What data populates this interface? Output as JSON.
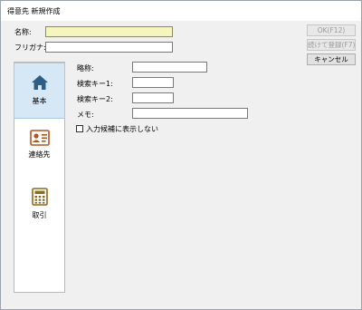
{
  "window": {
    "title": "得意先 新規作成"
  },
  "header": {
    "name_label": "名称:",
    "name_value": "",
    "kana_label": "フリガナ:",
    "kana_value": ""
  },
  "buttons": {
    "ok": "OK(F12)",
    "continue_register": "続けて登録(F7)",
    "cancel": "キャンセル"
  },
  "nav": {
    "items": [
      {
        "label": "基本",
        "icon": "home-icon",
        "selected": true
      },
      {
        "label": "連絡先",
        "icon": "contact-card-icon",
        "selected": false
      },
      {
        "label": "取引",
        "icon": "calculator-icon",
        "selected": false
      }
    ]
  },
  "form": {
    "abbr_label": "略称:",
    "search_key1_label": "検索キー1:",
    "search_key2_label": "検索キー2:",
    "memo_label": "メモ:",
    "hide_candidate_label": "入力候補に表示しない",
    "hide_candidate_checked": false
  },
  "colors": {
    "highlight_field": "#f6f5bd",
    "selected_nav": "#d6e7f6",
    "home_icon": "#2c5e86",
    "contact_icon": "#b5531d",
    "calculator_icon": "#8c6a1a"
  }
}
